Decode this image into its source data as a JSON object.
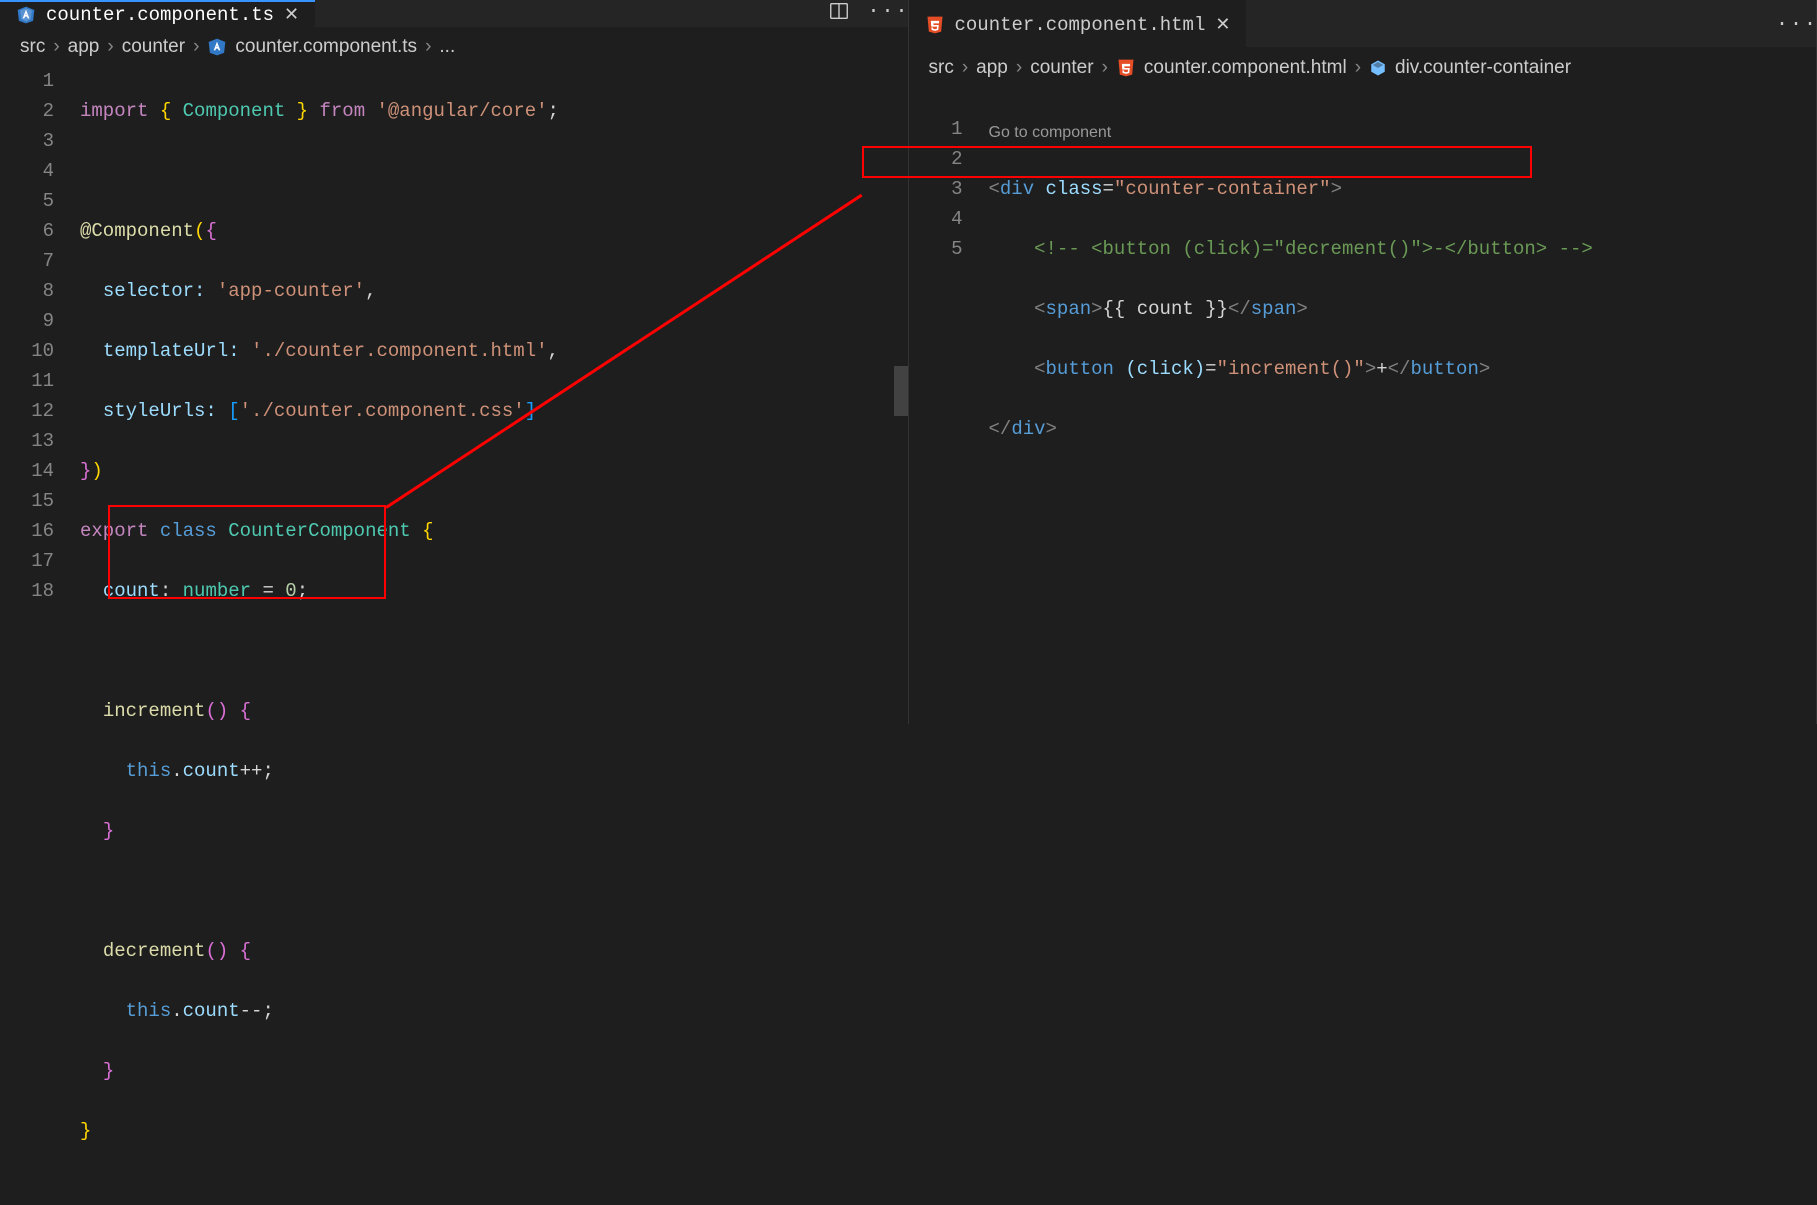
{
  "left": {
    "tab": {
      "filename": "counter.component.ts"
    },
    "breadcrumbs": [
      "src",
      "app",
      "counter",
      "counter.component.ts",
      "..."
    ],
    "lines": [
      "1",
      "2",
      "3",
      "4",
      "5",
      "6",
      "7",
      "8",
      "9",
      "10",
      "11",
      "12",
      "13",
      "14",
      "15",
      "16",
      "17",
      "18"
    ],
    "code": {
      "l1_import": "import",
      "l1_comp": "Component",
      "l1_from": "from",
      "l1_pkg": "'@angular/core'",
      "l3_dec": "@Component",
      "l4_key": "selector:",
      "l4_val": "'app-counter'",
      "l5_key": "templateUrl:",
      "l5_val": "'./counter.component.html'",
      "l6_key": "styleUrls:",
      "l6_val": "'./counter.component.css'",
      "l8_export": "export",
      "l8_class": "class",
      "l8_name": "CounterComponent",
      "l9_prop": "count",
      "l9_type": "number",
      "l9_val": "0",
      "l11_fn": "increment",
      "l12_this": "this",
      "l12_prop": "count",
      "l15_fn": "decrement",
      "l16_this": "this",
      "l16_prop": "count"
    }
  },
  "right": {
    "tab": {
      "filename": "counter.component.html"
    },
    "breadcrumbs": [
      "src",
      "app",
      "counter",
      "counter.component.html",
      "div.counter-container"
    ],
    "codelens": "Go to component",
    "lines": [
      "1",
      "2",
      "3",
      "4",
      "5"
    ],
    "code": {
      "l1_tag": "div",
      "l1_attr": "class",
      "l1_val": "\"counter-container\"",
      "l2_comment": "<!-- <button (click)=\"decrement()\">-</button> -->",
      "l3_tag": "span",
      "l3_expr": "{{ count }}",
      "l4_tag": "button",
      "l4_attr": "(click)",
      "l4_val": "\"increment()\"",
      "l4_txt": "+",
      "l5_tag": "div"
    }
  }
}
